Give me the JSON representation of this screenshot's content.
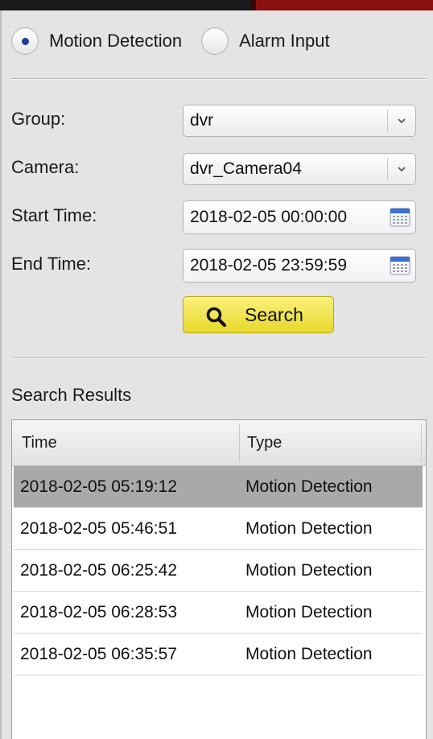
{
  "mode": {
    "options": [
      {
        "label": "Motion Detection",
        "selected": true
      },
      {
        "label": "Alarm Input",
        "selected": false
      }
    ]
  },
  "form": {
    "group_label": "Group:",
    "group_value": "dvr",
    "camera_label": "Camera:",
    "camera_value": "dvr_Camera04",
    "start_label": "Start Time:",
    "start_value": "2018-02-05 00:00:00",
    "end_label": "End Time:",
    "end_value": "2018-02-05 23:59:59",
    "search_label": "Search"
  },
  "results": {
    "title": "Search Results",
    "columns": [
      "Time",
      "Type"
    ],
    "rows": [
      {
        "time": "2018-02-05 05:19:12",
        "type": "Motion Detection",
        "selected": true
      },
      {
        "time": "2018-02-05 05:46:51",
        "type": "Motion Detection",
        "selected": false
      },
      {
        "time": "2018-02-05 06:25:42",
        "type": "Motion Detection",
        "selected": false
      },
      {
        "time": "2018-02-05 06:28:53",
        "type": "Motion Detection",
        "selected": false
      },
      {
        "time": "2018-02-05 06:35:57",
        "type": "Motion Detection",
        "selected": false
      }
    ]
  },
  "icons": {
    "dropdown": "chevron-down-icon",
    "calendar": "calendar-icon",
    "search": "magnifier-icon"
  },
  "colors": {
    "search_button": "#f0e34a",
    "selected_row": "#a9a9a9",
    "radio_dot": "#1f3b8c",
    "top_accent": "#8a0f0f"
  }
}
